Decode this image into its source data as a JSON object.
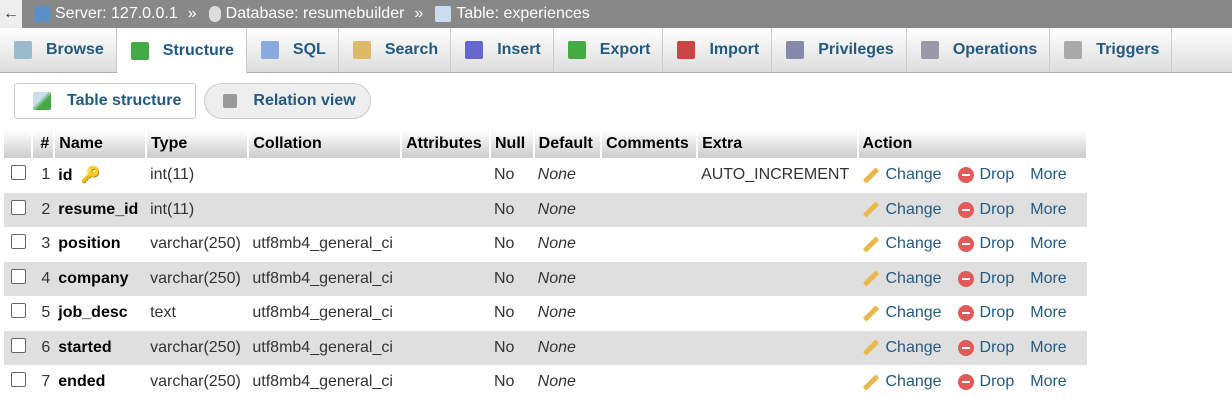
{
  "breadcrumb": {
    "back": "←",
    "server": "Server: 127.0.0.1",
    "database": "Database: resumebuilder",
    "table": "Table: experiences",
    "sep": "»"
  },
  "tabs": [
    {
      "label": "Browse",
      "icon": "browse-icon"
    },
    {
      "label": "Structure",
      "icon": "structure-icon",
      "active": true
    },
    {
      "label": "SQL",
      "icon": "sql-icon"
    },
    {
      "label": "Search",
      "icon": "search-icon"
    },
    {
      "label": "Insert",
      "icon": "insert-icon"
    },
    {
      "label": "Export",
      "icon": "export-icon"
    },
    {
      "label": "Import",
      "icon": "import-icon"
    },
    {
      "label": "Privileges",
      "icon": "privileges-icon"
    },
    {
      "label": "Operations",
      "icon": "wrench-icon"
    },
    {
      "label": "Triggers",
      "icon": "triggers-icon"
    }
  ],
  "subnav": {
    "table_structure": "Table structure",
    "relation_view": "Relation view"
  },
  "columns": [
    "#",
    "Name",
    "Type",
    "Collation",
    "Attributes",
    "Null",
    "Default",
    "Comments",
    "Extra",
    "Action"
  ],
  "actions": {
    "change": "Change",
    "drop": "Drop",
    "more": "More"
  },
  "rows": [
    {
      "n": "1",
      "name": "id",
      "type": "int(11)",
      "collation": "",
      "null": "No",
      "default": "None",
      "extra": "AUTO_INCREMENT",
      "primary": true
    },
    {
      "n": "2",
      "name": "resume_id",
      "type": "int(11)",
      "collation": "",
      "null": "No",
      "default": "None",
      "extra": ""
    },
    {
      "n": "3",
      "name": "position",
      "type": "varchar(250)",
      "collation": "utf8mb4_general_ci",
      "null": "No",
      "default": "None",
      "extra": ""
    },
    {
      "n": "4",
      "name": "company",
      "type": "varchar(250)",
      "collation": "utf8mb4_general_ci",
      "null": "No",
      "default": "None",
      "extra": ""
    },
    {
      "n": "5",
      "name": "job_desc",
      "type": "text",
      "collation": "utf8mb4_general_ci",
      "null": "No",
      "default": "None",
      "extra": ""
    },
    {
      "n": "6",
      "name": "started",
      "type": "varchar(250)",
      "collation": "utf8mb4_general_ci",
      "null": "No",
      "default": "None",
      "extra": ""
    },
    {
      "n": "7",
      "name": "ended",
      "type": "varchar(250)",
      "collation": "utf8mb4_general_ci",
      "null": "No",
      "default": "None",
      "extra": ""
    }
  ]
}
